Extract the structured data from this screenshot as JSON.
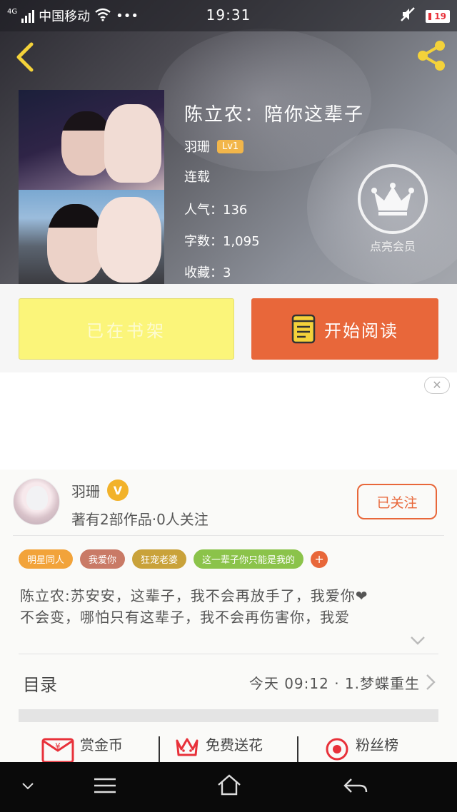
{
  "status_bar": {
    "network_type": "4G",
    "carrier": "中国移动",
    "more": "•••",
    "time": "19:31",
    "battery": "19"
  },
  "book": {
    "title": "陈立农：陪你这辈子",
    "author": "羽珊",
    "level": "Lv1",
    "status": "连载",
    "popularity": "人气：136",
    "word_count": "字数：1,095",
    "favorites": "收藏：3",
    "vip_label": "点亮会员"
  },
  "actions": {
    "on_shelf": "已在书架",
    "start_reading": "开始阅读"
  },
  "ad": {
    "close": "✕"
  },
  "author_card": {
    "name": "羽珊",
    "verified_badge": "V",
    "stats": "著有2部作品·0人关注",
    "follow_button": "已关注"
  },
  "tags": [
    {
      "label": "明星同人",
      "color": "#f2a33a"
    },
    {
      "label": "我爱你",
      "color": "#c97a66"
    },
    {
      "label": "狂宠老婆",
      "color": "#c9a23a"
    },
    {
      "label": "这一辈子你只能是我的",
      "color": "#8bc34a"
    }
  ],
  "tag_add": "+",
  "intro": {
    "line1": "陈立农:苏安安，这辈子，我不会再放手了，我爱你❤",
    "line2": "不会变，哪怕只有这辈子，我不会再伤害你，我爱"
  },
  "toc": {
    "label": "目录",
    "latest": "今天 09:12 · 1.梦蝶重生"
  },
  "bottom_actions": {
    "reward": "赏金币",
    "send_flower": "免费送花",
    "fans": "粉丝榜"
  },
  "colors": {
    "accent": "#e8673a",
    "shelf_button": "#fbf57a",
    "level_badge": "#f2b64a"
  }
}
